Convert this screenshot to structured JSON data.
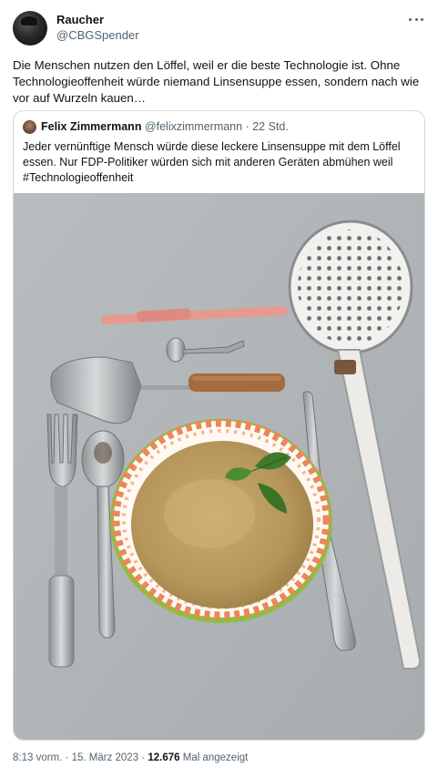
{
  "author": {
    "display_name": "Raucher",
    "handle": "@CBGSpender"
  },
  "tweet": {
    "text": "Die Menschen nutzen den Löffel, weil er die beste Technologie ist. Ohne Technologieoffenheit würde niemand Linsensuppe essen, sondern nach wie vor auf Wurzeln kauen…"
  },
  "quote": {
    "display_name": "Felix Zimmermann",
    "handle": "@felixzimmermann",
    "separator": "·",
    "time": "22 Std.",
    "text": "Jeder vernünftige Mensch würde diese leckere Linsensuppe mit dem Löffel essen. Nur FDP-Politiker würden sich mit anderen Geräten abmühen weil #Technologieoffenheit"
  },
  "footer": {
    "time": "8:13 vorm.",
    "separator": "·",
    "date": "15. März 2023",
    "views_count": "12.676",
    "views_label": "Mal angezeigt"
  },
  "icons": {
    "more": "more-horizontal-icon"
  }
}
